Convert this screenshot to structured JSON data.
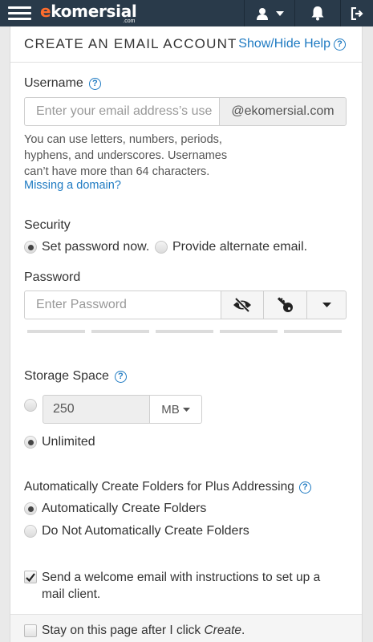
{
  "header": {
    "logo_main": "komersial",
    "logo_accent": "e",
    "logo_sub": ".com"
  },
  "section": {
    "title": "CREATE AN EMAIL ACCOUNT",
    "help_toggle": "Show/Hide Help"
  },
  "username": {
    "label": "Username",
    "placeholder": "Enter your email address’s use",
    "domain": "@ekomersial.com",
    "hint": "You can use letters, numbers, periods, hyphens, and underscores. Usernames can’t have more than 64 characters.",
    "missing_domain_link": "Missing a domain?"
  },
  "security": {
    "label": "Security",
    "options": [
      {
        "label": "Set password now.",
        "checked": true
      },
      {
        "label": "Provide alternate email.",
        "checked": false
      }
    ]
  },
  "password": {
    "label": "Password",
    "placeholder": "Enter Password",
    "strength_segments": 5
  },
  "storage": {
    "label": "Storage Space",
    "custom_value": "250",
    "unit": "MB",
    "custom_checked": false,
    "unlimited_label": "Unlimited",
    "unlimited_checked": true
  },
  "folders": {
    "label": "Automatically Create Folders for Plus Addressing",
    "options": [
      {
        "label": "Automatically Create Folders",
        "checked": true
      },
      {
        "label": "Do Not Automatically Create Folders",
        "checked": false
      }
    ]
  },
  "welcome_email": {
    "label": "Send a welcome email with instructions to set up a mail client.",
    "checked": true
  },
  "stay_on_page": {
    "label_prefix": "Stay on this page after I click ",
    "label_emphasis": "Create",
    "label_suffix": ".",
    "checked": false
  },
  "colors": {
    "topbar": "#293a4a",
    "link": "#1e7ac2",
    "logo_accent": "#ff6c2c"
  }
}
